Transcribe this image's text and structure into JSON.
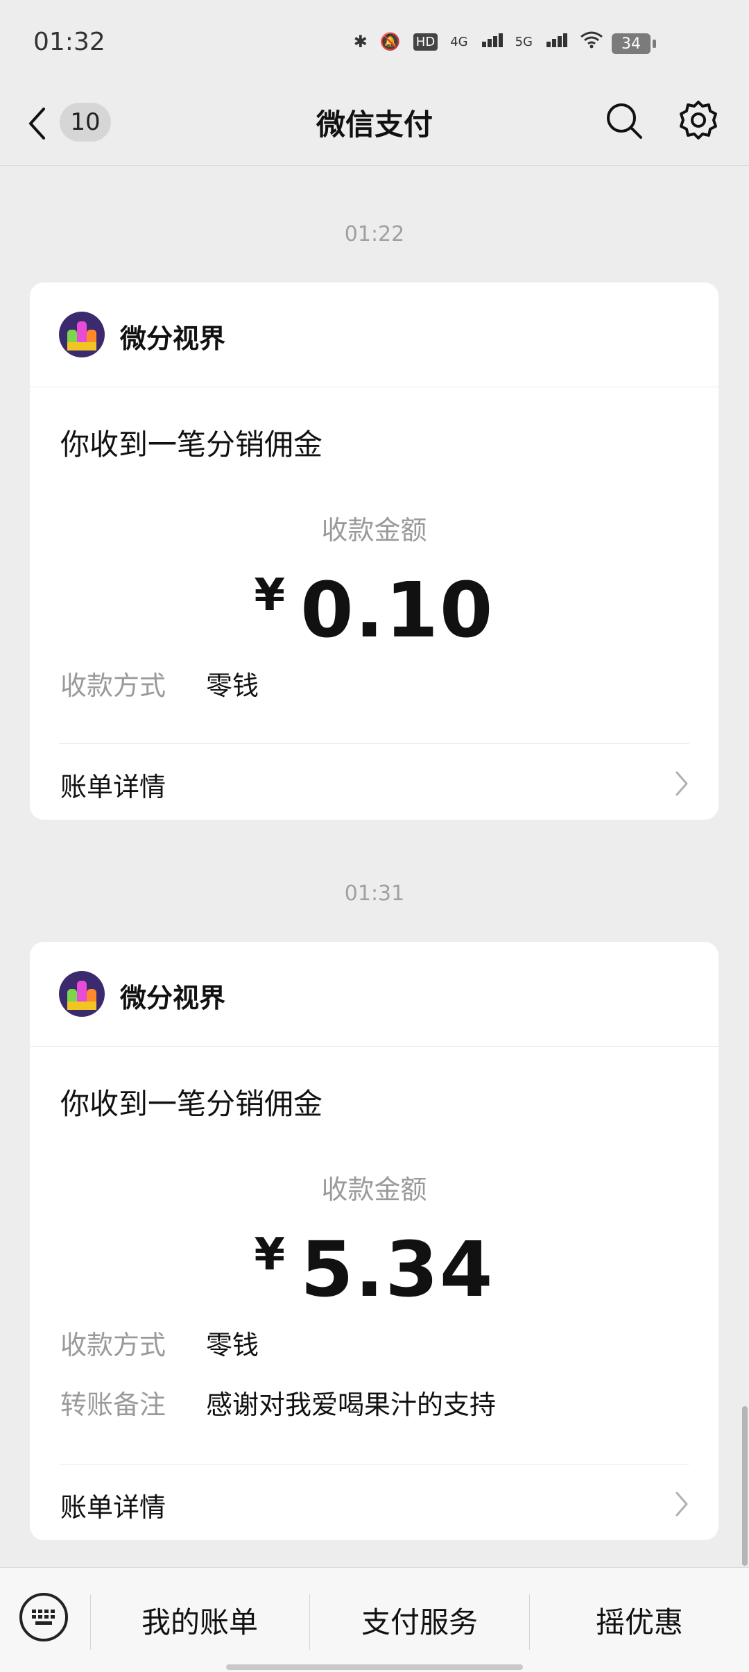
{
  "status": {
    "time": "01:32",
    "battery": "34",
    "network1": "4G",
    "network2": "5G",
    "hd": "HD"
  },
  "header": {
    "badge": "10",
    "title": "微信支付"
  },
  "messages": [
    {
      "timestamp": "01:22",
      "merchant": "微分视界",
      "headline": "你收到一笔分销佣金",
      "amount_label": "收款金额",
      "currency": "¥",
      "amount": "0.10",
      "method_key": "收款方式",
      "method_value": "零钱",
      "detail_link": "账单详情"
    },
    {
      "timestamp": "01:31",
      "merchant": "微分视界",
      "headline": "你收到一笔分销佣金",
      "amount_label": "收款金额",
      "currency": "¥",
      "amount": "5.34",
      "method_key": "收款方式",
      "method_value": "零钱",
      "note_key": "转账备注",
      "note_value": "感谢对我爱喝果汁的支持",
      "detail_link": "账单详情"
    }
  ],
  "bottom_menu": {
    "items": [
      "我的账单",
      "支付服务",
      "摇优惠"
    ],
    "keyboard_icon": "keyboard-icon"
  }
}
